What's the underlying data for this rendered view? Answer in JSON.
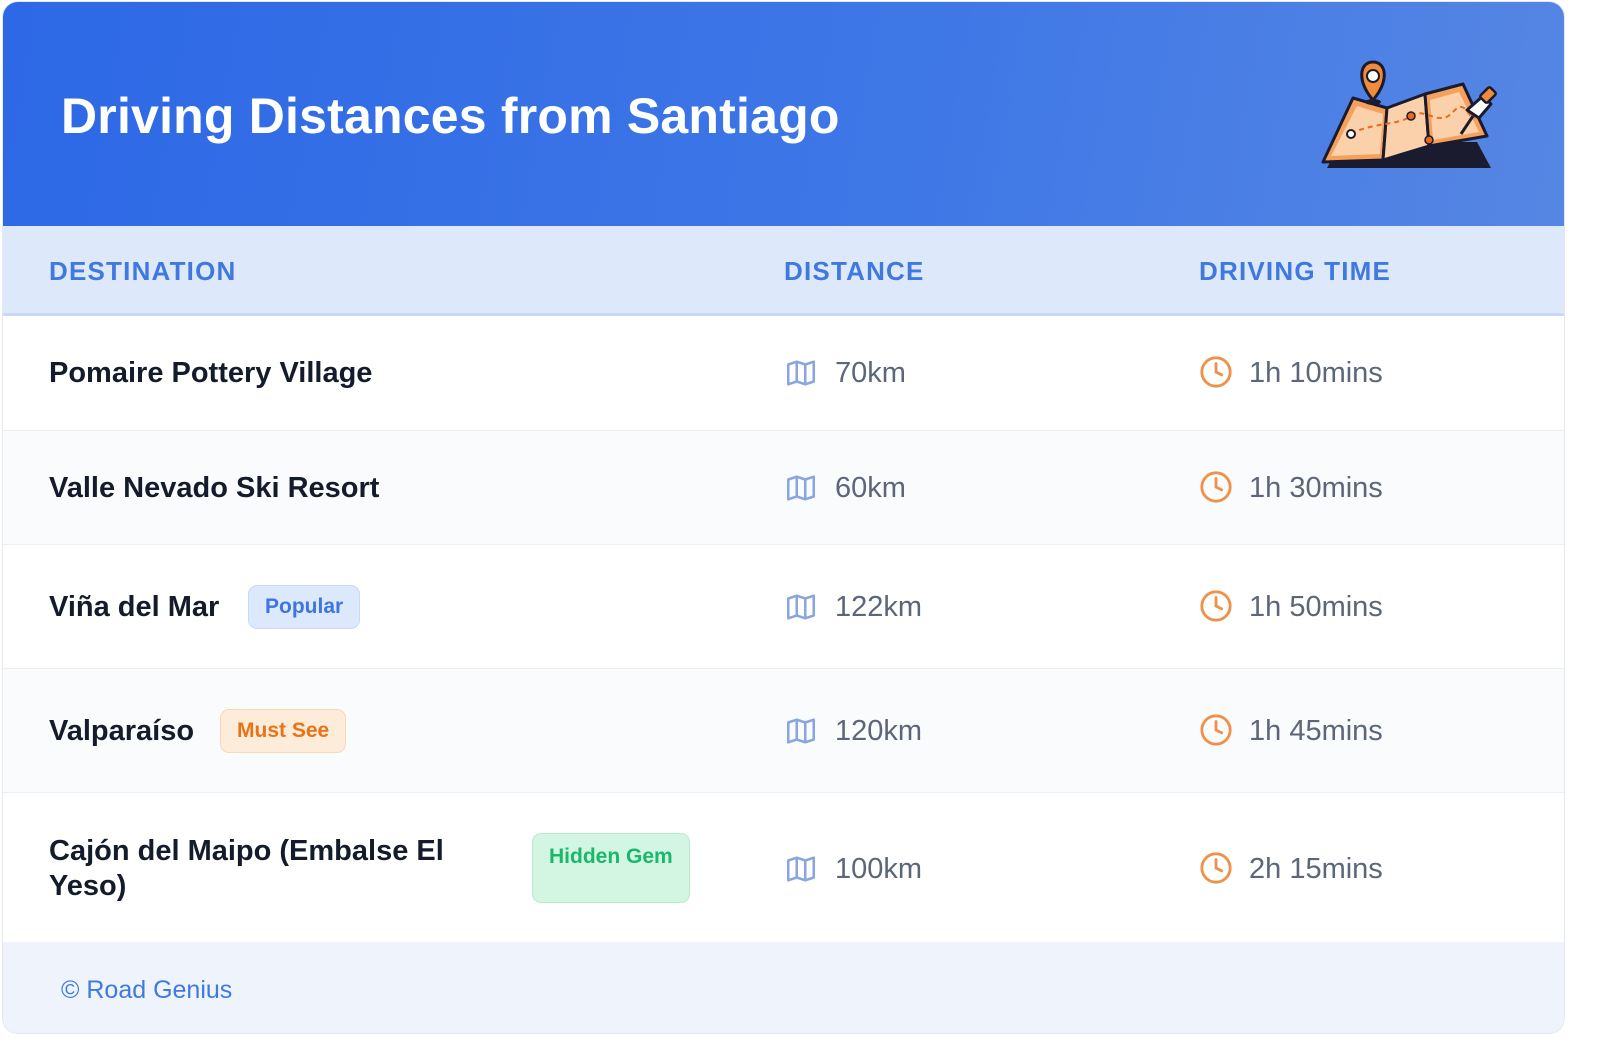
{
  "header": {
    "title": "Driving Distances from Santiago"
  },
  "table": {
    "columns": [
      "DESTINATION",
      "DISTANCE",
      "DRIVING TIME"
    ],
    "rows": [
      {
        "destination": "Pomaire Pottery Village",
        "badge": "",
        "distance": "70km",
        "time": "1h 10mins"
      },
      {
        "destination": "Valle Nevado Ski Resort",
        "badge": "",
        "distance": "60km",
        "time": "1h 30mins"
      },
      {
        "destination": "Viña del Mar",
        "badge": "Popular",
        "distance": "122km",
        "time": "1h 50mins"
      },
      {
        "destination": "Valparaíso",
        "badge": "Must See",
        "distance": "120km",
        "time": "1h 45mins"
      },
      {
        "destination": "Cajón del Maipo (Embalse El Yeso)",
        "badge": "Hidden Gem",
        "distance": "100km",
        "time": "2h 15mins"
      }
    ]
  },
  "icons": {
    "header": "folded-map-with-pins-icon",
    "distance": "map-icon",
    "time": "clock-icon"
  },
  "colors": {
    "header_blue": "#2d68e6",
    "accent_orange": "#ea7317",
    "badge_popular": "#3d76df",
    "badge_must_see": "#ea7317",
    "badge_hidden_gem": "#19b86a"
  },
  "footer": {
    "credit": "© Road Genius"
  }
}
